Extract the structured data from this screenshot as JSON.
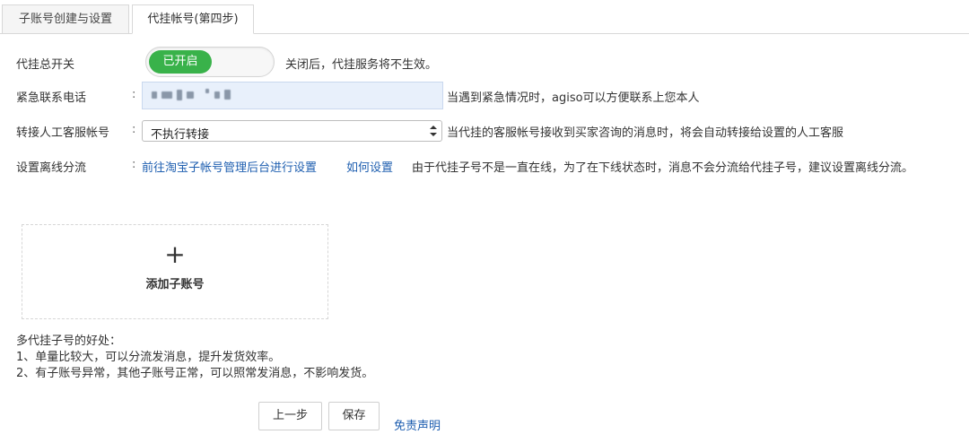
{
  "tabs": [
    {
      "label": "子账号创建与设置"
    },
    {
      "label": "代挂帐号(第四步)"
    }
  ],
  "form": {
    "toggle": {
      "label": "代挂总开关",
      "state_text": "已开启",
      "hint": "关闭后，代挂服务将不生效。",
      "on_color": "#39b24a"
    },
    "phone": {
      "label": "紧急联系电话",
      "colon": ":",
      "hint": "当遇到紧急情况时，agiso可以方便联系上您本人"
    },
    "transfer": {
      "label": "转接人工客服帐号",
      "colon": ":",
      "selected": "不执行转接",
      "hint": "当代挂的客服帐号接收到买家咨询的消息时，将会自动转接给设置的人工客服"
    },
    "offline": {
      "label": "设置离线分流",
      "colon": ":",
      "link1": "前往淘宝子帐号管理后台进行设置",
      "link2": "如何设置",
      "hint": "由于代挂子号不是一直在线，为了在下线状态时，消息不会分流给代挂子号，建议设置离线分流。"
    }
  },
  "add_sub": {
    "plus": "+",
    "label": "添加子账号"
  },
  "benefits": {
    "title": "多代挂子号的好处：",
    "items": [
      "1、单量比较大，可以分流发消息，提升发货效率。",
      "2、有子账号异常，其他子账号正常，可以照常发消息，不影响发货。"
    ]
  },
  "actions": {
    "prev": "上一步",
    "save": "保存",
    "disclaimer": "免责声明"
  },
  "colors": {
    "link": "#1f5fb0",
    "toggle_on": "#39b24a"
  }
}
